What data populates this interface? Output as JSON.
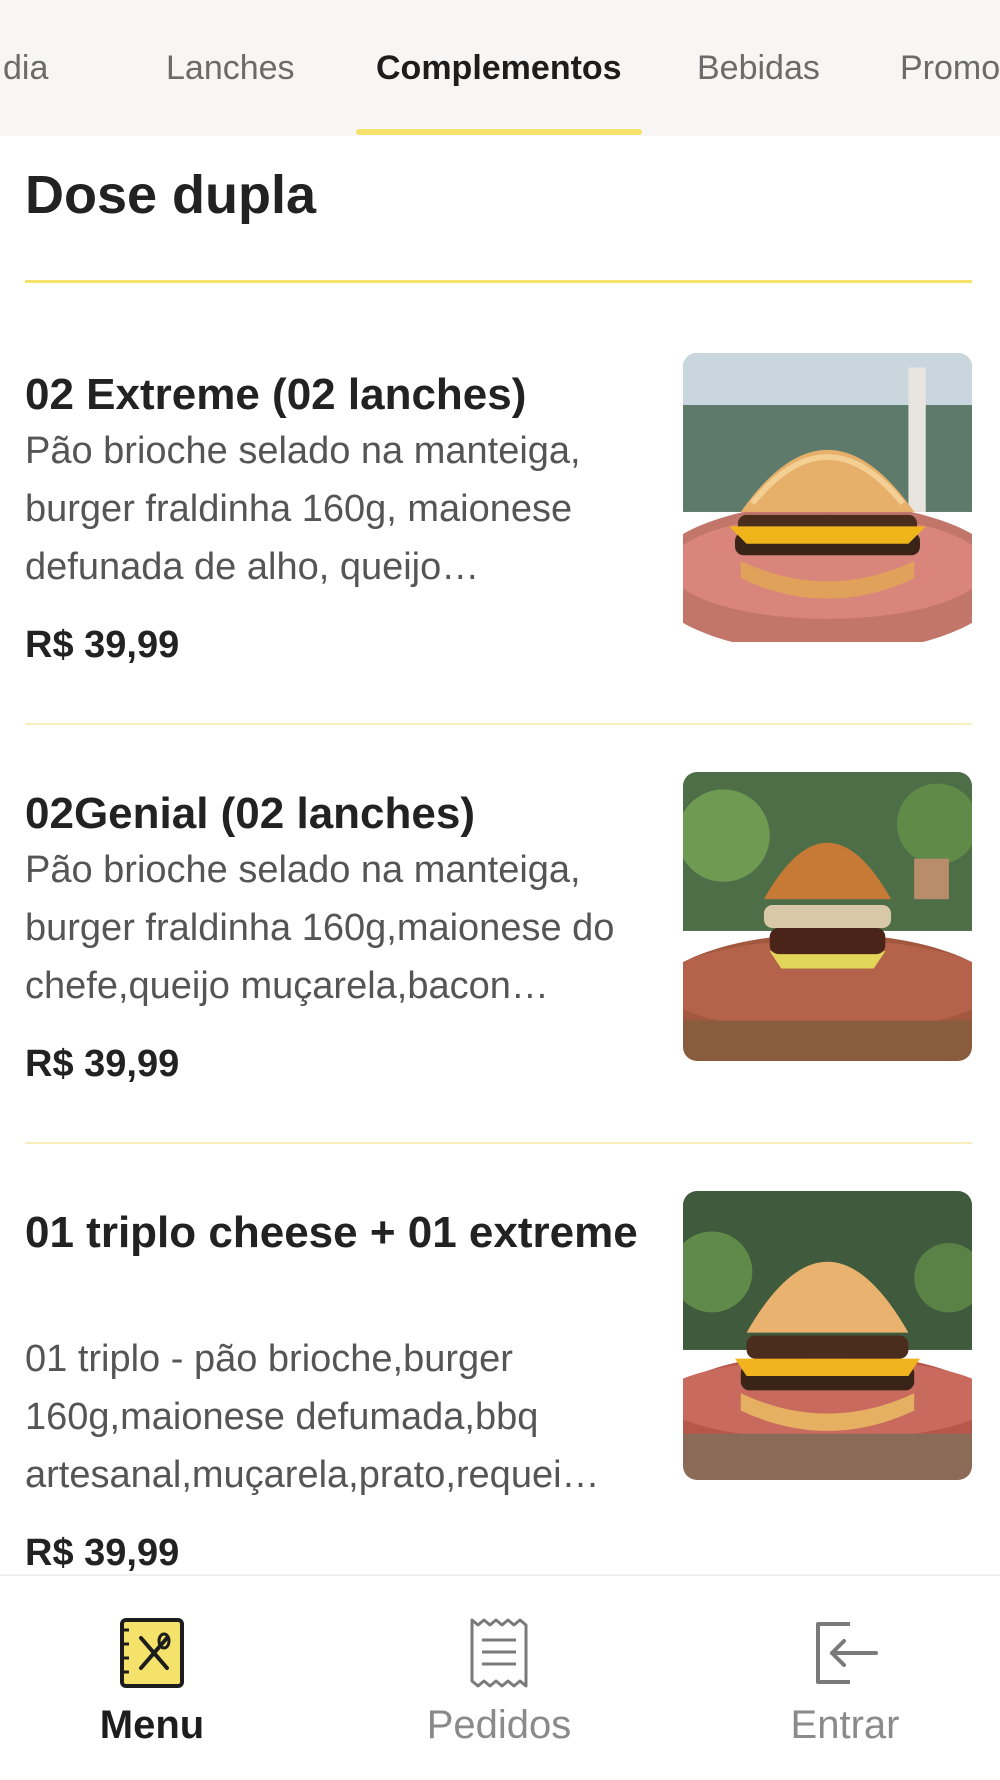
{
  "tabs": [
    {
      "label": "Prato do dia"
    },
    {
      "label": "Lanches"
    },
    {
      "label": "Complementos",
      "active": true
    },
    {
      "label": "Bebidas"
    },
    {
      "label": "Promoções"
    }
  ],
  "section": {
    "title": "Dose dupla"
  },
  "items": [
    {
      "name": "02 Extreme (02 lanches)",
      "description": "Pão brioche selado na manteiga, burger fraldinha 160g, maionese defunada de alho, queijo…",
      "price": "R$ 39,99",
      "image": "burger-photo"
    },
    {
      "name": "02Genial (02 lanches)",
      "description": "Pão brioche selado na manteiga, burger fraldinha 160g,maionese do chefe,queijo muçarela,bacon…",
      "price": "R$ 39,99",
      "image": "burger-photo"
    },
    {
      "name": "01 triplo cheese + 01 extreme",
      "description": "01 triplo - pão brioche,burger 160g,maionese defumada,bbq artesanal,muçarela,prato,requei…",
      "price": "R$ 39,99",
      "image": "burger-photo"
    }
  ],
  "bottom_nav": [
    {
      "label": "Menu",
      "icon": "menu-book-icon",
      "active": true
    },
    {
      "label": "Pedidos",
      "icon": "receipt-icon"
    },
    {
      "label": "Entrar",
      "icon": "login-icon"
    }
  ],
  "colors": {
    "accent": "#f5e26b",
    "text": "#222222",
    "muted": "#8a8a8a"
  }
}
